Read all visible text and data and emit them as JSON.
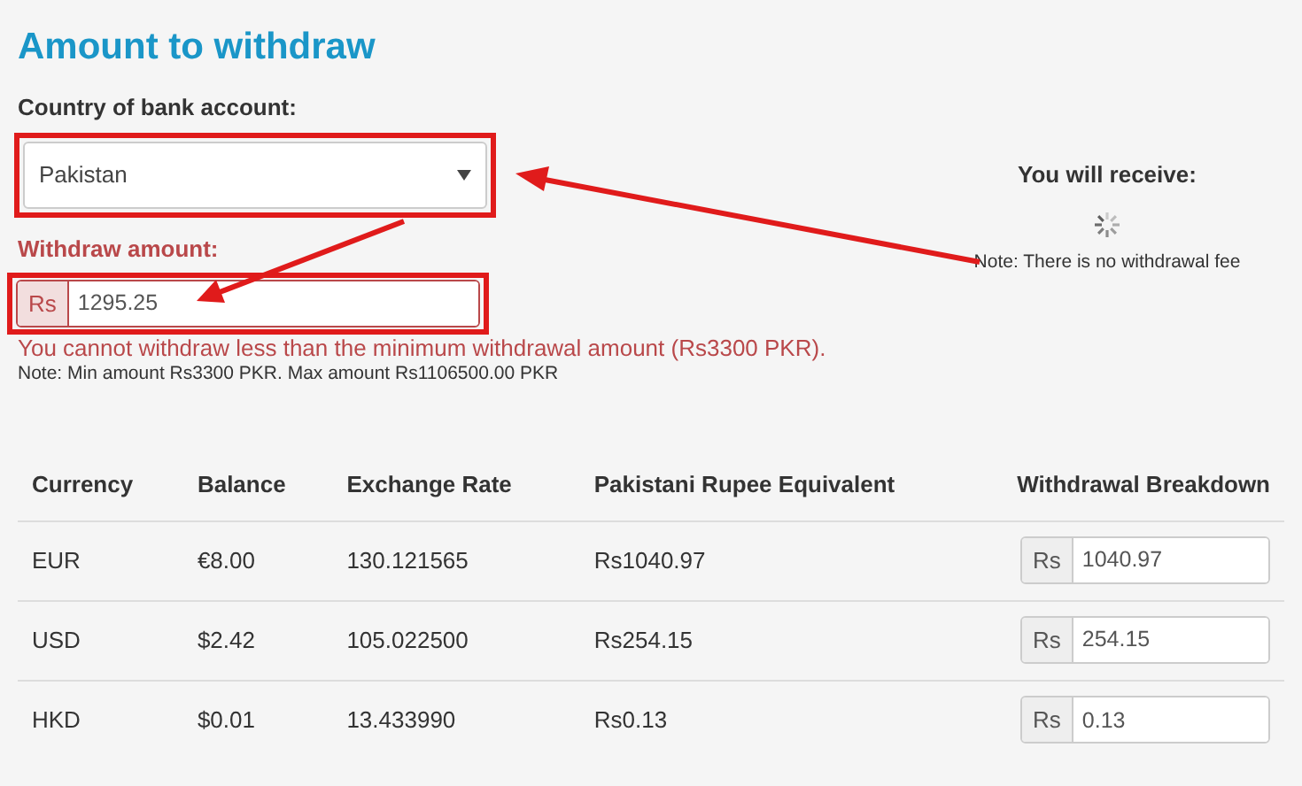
{
  "title": "Amount to withdraw",
  "country": {
    "label": "Country of bank account:",
    "value": "Pakistan"
  },
  "amount": {
    "label": "Withdraw amount:",
    "prefix": "Rs",
    "value": "1295.25",
    "invalid": true,
    "error": "You cannot withdraw less than the minimum withdrawal amount (Rs3300 PKR).",
    "note": "Note: Min amount Rs3300 PKR. Max amount Rs1106500.00 PKR"
  },
  "receive": {
    "label": "You will receive:",
    "loading": true,
    "note": "Note: There is no withdrawal fee"
  },
  "table": {
    "columns": [
      "Currency",
      "Balance",
      "Exchange Rate",
      "Pakistani Rupee Equivalent",
      "Withdrawal Breakdown"
    ],
    "rows": [
      {
        "currency": "EUR",
        "balance": "€8.00",
        "rate": "130.121565",
        "equivalent": "Rs1040.97",
        "prefix": "Rs",
        "breakdown": "1040.97"
      },
      {
        "currency": "USD",
        "balance": "$2.42",
        "rate": "105.022500",
        "equivalent": "Rs254.15",
        "prefix": "Rs",
        "breakdown": "254.15"
      },
      {
        "currency": "HKD",
        "balance": "$0.01",
        "rate": "13.433990",
        "equivalent": "Rs0.13",
        "prefix": "Rs",
        "breakdown": "0.13"
      }
    ]
  }
}
